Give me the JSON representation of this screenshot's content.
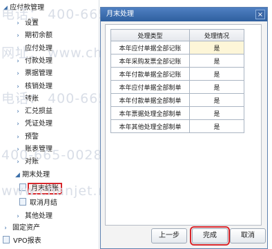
{
  "watermark": {
    "phone": "400-665-0028",
    "phone_label": "电话：",
    "site": "www.chanjet.net",
    "site_label": "网址："
  },
  "tree": {
    "root": "应付款管理",
    "items": [
      {
        "label": "设置"
      },
      {
        "label": "期初余额"
      },
      {
        "label": "应付处理"
      },
      {
        "label": "付款处理"
      },
      {
        "label": "票据管理"
      },
      {
        "label": "核销处理"
      },
      {
        "label": "转账"
      },
      {
        "label": "汇兑损益"
      },
      {
        "label": "凭证处理"
      },
      {
        "label": "预警"
      },
      {
        "label": "账表管理"
      },
      {
        "label": "对账"
      }
    ],
    "period_end": "期末处理",
    "period_children": [
      "月末结账",
      "取消月结"
    ],
    "other": "其他处理",
    "fixed_assets": "固定资产",
    "vpo": "VPO报表"
  },
  "dialog": {
    "title": "月末处理",
    "close": "×",
    "col_type": "处理类型",
    "col_status": "处理情况",
    "rows": [
      {
        "type": "本年应付单据全部记账",
        "status": "是"
      },
      {
        "type": "本年采购发票全部记账",
        "status": "是"
      },
      {
        "type": "本年付款单据全部记账",
        "status": "是"
      },
      {
        "type": "本年应付单据全部制单",
        "status": "是"
      },
      {
        "type": "本年付款单据全部制单",
        "status": "是"
      },
      {
        "type": "本年票据处理全部制单",
        "status": "是"
      },
      {
        "type": "本年其他处理全部制单",
        "status": "是"
      }
    ],
    "buttons": {
      "prev": "上一步",
      "finish": "完成",
      "cancel": "取消"
    }
  }
}
